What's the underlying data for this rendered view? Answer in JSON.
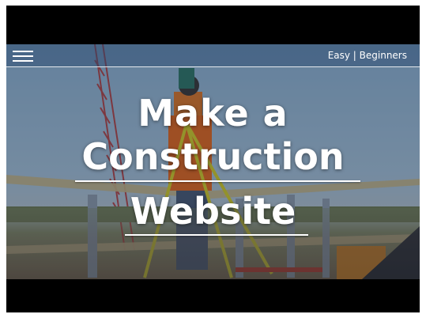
{
  "header": {
    "menu_icon": "hamburger-menu-icon",
    "difficulty_label": "Easy | Beginners"
  },
  "hero": {
    "title_line1": "Make a",
    "title_line2": "Construction",
    "title_line3": "Website"
  },
  "colors": {
    "overlay": "#28466e",
    "text": "#ffffff",
    "letterbox": "#000000"
  }
}
